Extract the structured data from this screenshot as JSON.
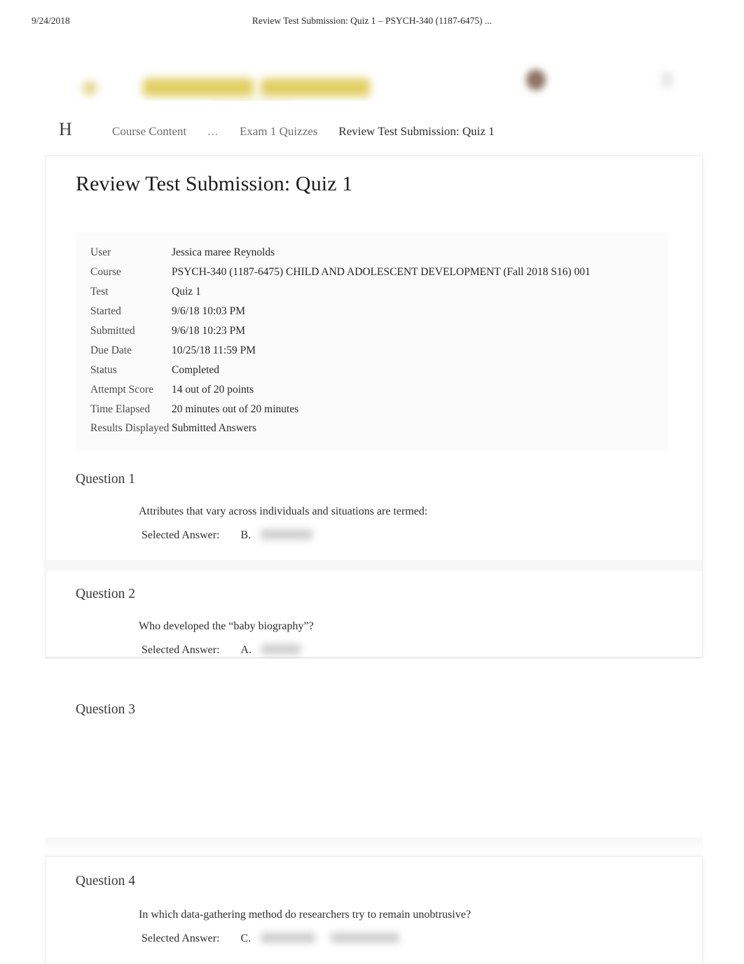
{
  "print_header": {
    "date": "9/24/2018",
    "title": "Review Test Submission: Quiz 1 – PSYCH-340 (1187-6475) ..."
  },
  "brand": {
    "logo_icon": "blurred-institution-logo",
    "avatar_icon": "blurred-user-avatar",
    "right_icon": "blurred-header-icon",
    "accent_color": "#ddc84e"
  },
  "breadcrumb": {
    "home_label": "H",
    "items": [
      {
        "label": "Course Content",
        "current": false
      },
      {
        "label": "...",
        "current": false
      },
      {
        "label": "Exam 1 Quizzes",
        "current": false
      },
      {
        "label": "Review Test Submission: Quiz 1",
        "current": true
      }
    ]
  },
  "page_title": "Review Test Submission: Quiz 1",
  "info_table": {
    "rows": [
      {
        "label": "User",
        "value": "Jessica maree Reynolds"
      },
      {
        "label": "Course",
        "value": "PSYCH-340 (1187-6475) CHILD AND ADOLESCENT DEVELOPMENT (Fall 2018 S16) 001"
      },
      {
        "label": "Test",
        "value": "Quiz 1"
      },
      {
        "label": "Started",
        "value": "9/6/18 10:03 PM"
      },
      {
        "label": "Submitted",
        "value": "9/6/18 10:23 PM"
      },
      {
        "label": "Due Date",
        "value": "10/25/18 11:59 PM"
      },
      {
        "label": "Status",
        "value": "Completed"
      },
      {
        "label": "Attempt Score",
        "value": "14 out of 20 points"
      },
      {
        "label": "Time Elapsed",
        "value": "20 minutes out of 20 minutes"
      },
      {
        "label": "Results Displayed",
        "value": "Submitted Answers"
      }
    ]
  },
  "questions": [
    {
      "heading": "Question 1",
      "text": "Attributes that vary across individuals and situations are termed:",
      "answer_label": "Selected Answer:",
      "answer_letter": "B.",
      "answer_text": ""
    },
    {
      "heading": "Question 2",
      "text": "Who developed the “baby biography”?",
      "answer_label": "Selected Answer:",
      "answer_letter": "A.",
      "answer_text": ""
    },
    {
      "heading": "Question 3",
      "text": "",
      "answer_label": "",
      "answer_letter": "",
      "answer_text": ""
    },
    {
      "heading": "Question 4",
      "text": "In which data-gathering method do researchers try to remain unobtrusive?",
      "answer_label": "Selected Answer:",
      "answer_letter": "C.",
      "answer_text": ""
    }
  ]
}
